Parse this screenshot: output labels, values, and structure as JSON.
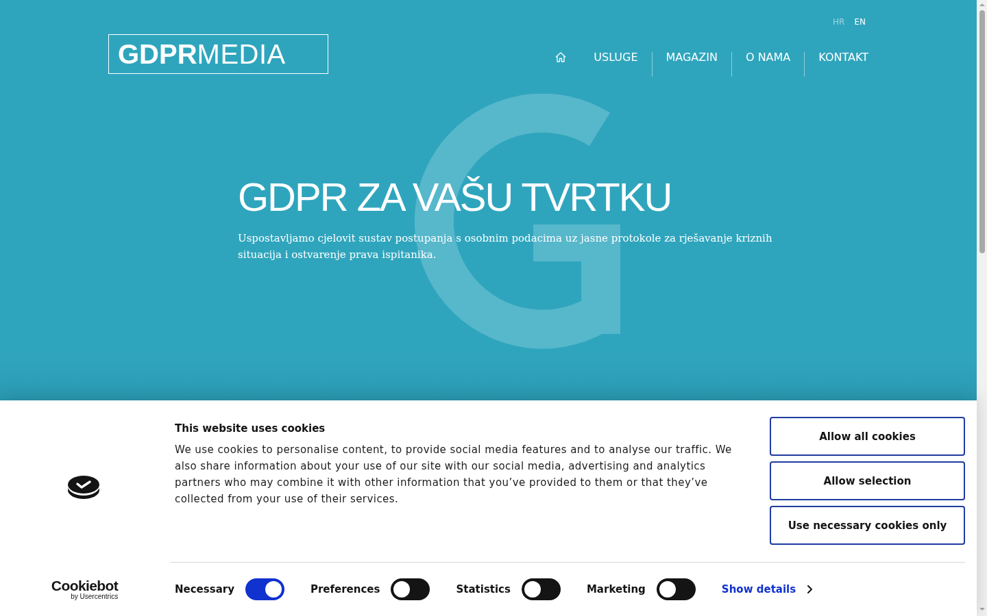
{
  "header": {
    "languages": [
      {
        "label": "HR",
        "selected": false
      },
      {
        "label": "EN",
        "selected": true
      }
    ],
    "logo": "**GDPR**MEDIA",
    "nav": [
      {
        "kind": "home"
      },
      {
        "kind": "link",
        "label": "USLUGE"
      },
      {
        "kind": "link",
        "label": "MAGAZIN"
      },
      {
        "kind": "link",
        "label": "O NAMA"
      },
      {
        "kind": "link",
        "label": "KONTAKT"
      }
    ]
  },
  "hero": {
    "title": "GDPR ZA VAŠU TVRTKU",
    "text": "Uspostavljamo cjelovit sustav postupanja s osobnim podacima uz jasne protokole za rješavanje kriznih situacija i ostvarenje prava ispitanika."
  },
  "cookie_banner": {
    "title": "This website uses cookies",
    "body": "We use cookies to personalise content, to provide social media features and to analyse our traffic. We also share information about your use of our site with our social media, advertising and analytics partners who may combine it with other information that you’ve provided to them or that they’ve collected from your use of their services.",
    "buttons": [
      "Allow all cookies",
      "Allow selection",
      "Use necessary cookies only"
    ],
    "brand": {
      "name": "Cookiebot",
      "byline": "by Usercentrics"
    },
    "categories": [
      {
        "label": "Necessary",
        "on": true
      },
      {
        "label": "Preferences",
        "on": false
      },
      {
        "label": "Statistics",
        "on": false
      },
      {
        "label": "Marketing",
        "on": false
      }
    ],
    "details_link": "Show details"
  }
}
